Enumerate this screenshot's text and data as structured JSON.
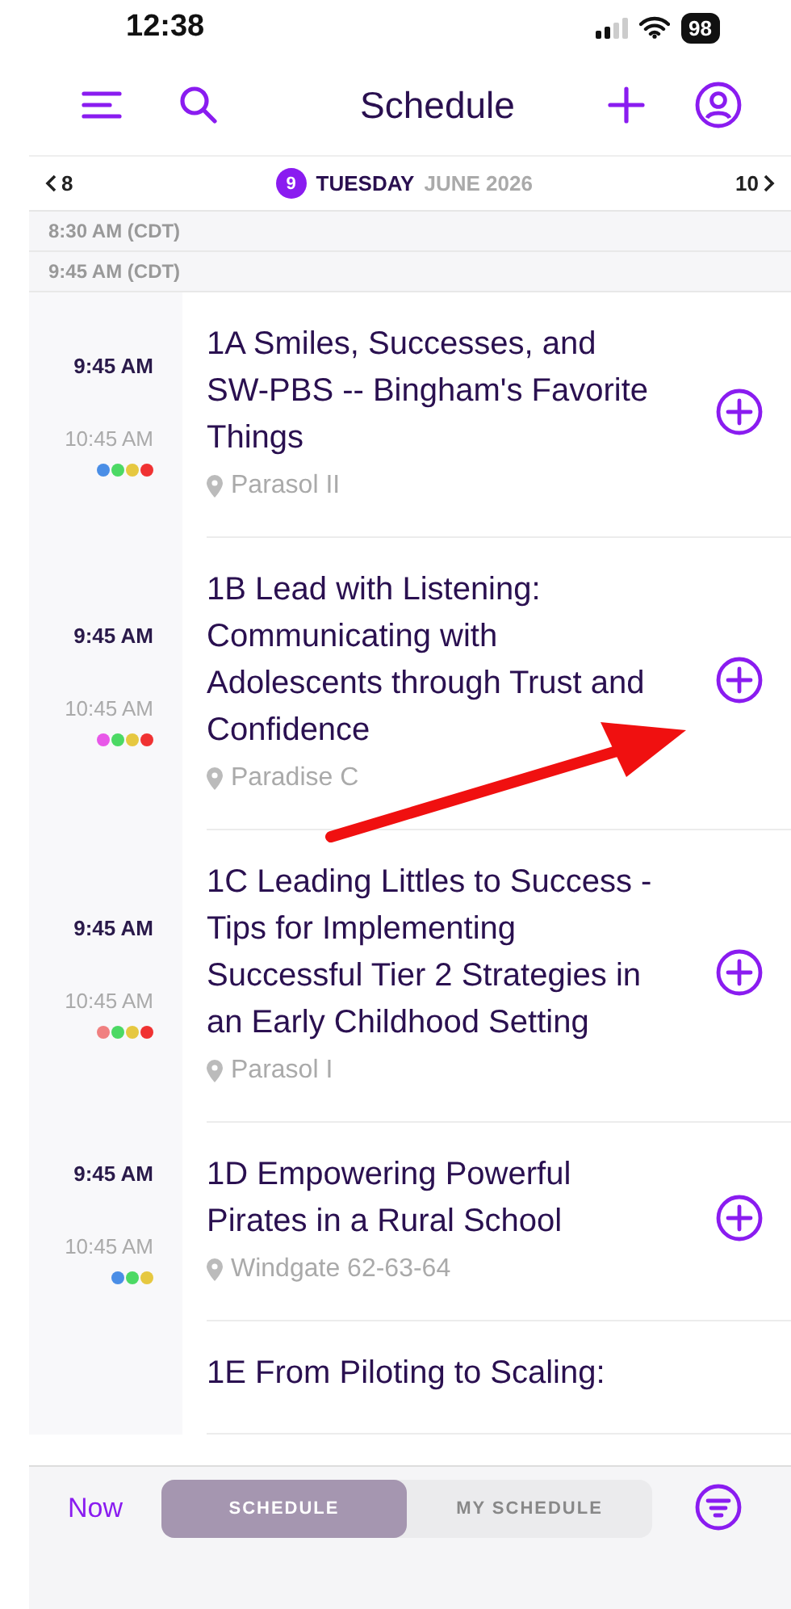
{
  "status_bar": {
    "time": "12:38",
    "battery": "98"
  },
  "nav": {
    "title": "Schedule"
  },
  "date_bar": {
    "prev": "8",
    "day_number": "9",
    "weekday": "TUESDAY",
    "month_year": "JUNE 2026",
    "next": "10"
  },
  "time_headers": [
    "8:30 AM (CDT)",
    "9:45 AM (CDT)"
  ],
  "sessions": [
    {
      "start": "9:45 AM",
      "end": "10:45 AM",
      "title": "1A Smiles, Successes, and SW-PBS -- Bingham's Favorite Things",
      "location": "Parasol II",
      "added": false,
      "tags": [
        {
          "color": "#4a8ee6"
        },
        {
          "color": "#4cd964"
        },
        {
          "color": "#e6c840"
        },
        {
          "color": "#f03232"
        }
      ]
    },
    {
      "start": "9:45 AM",
      "end": "10:45 AM",
      "title": "1B Lead with Listening: Communicating with Adolescents through Trust and Confidence",
      "location": "Paradise C",
      "added": false,
      "tags": [
        {
          "color": "#e858e8"
        },
        {
          "color": "#4cd964"
        },
        {
          "color": "#e6c840"
        },
        {
          "color": "#f03232"
        }
      ]
    },
    {
      "start": "9:45 AM",
      "end": "10:45 AM",
      "title": "1C Leading Littles to Success - Tips for Implementing Successful Tier 2 Strategies in an Early Childhood Setting",
      "location": "Parasol I",
      "added": false,
      "tags": [
        {
          "color": "#f08080"
        },
        {
          "color": "#4cd964"
        },
        {
          "color": "#e6c840"
        },
        {
          "color": "#f03232"
        }
      ]
    },
    {
      "start": "9:45 AM",
      "end": "10:45 AM",
      "title": "1D Empowering Powerful Pirates in a Rural School",
      "location": "Windgate 62-63-64",
      "added": false,
      "tags": [
        {
          "color": "#4a8ee6"
        },
        {
          "color": "#4cd964"
        },
        {
          "color": "#e6c840"
        }
      ]
    },
    {
      "title": "1E From Piloting to Scaling:"
    }
  ],
  "bottom_bar": {
    "now": "Now",
    "segments": [
      {
        "label": "SCHEDULE",
        "selected": true
      },
      {
        "label": "MY SCHEDULE",
        "selected": false
      }
    ]
  }
}
